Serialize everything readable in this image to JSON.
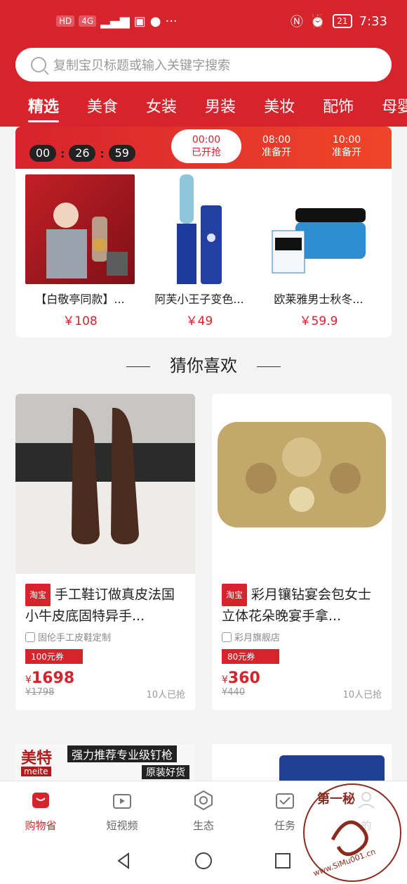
{
  "status": {
    "left_badges": [
      "HD",
      "4G"
    ],
    "time": "7:33",
    "battery": "21"
  },
  "search": {
    "placeholder": "复制宝贝标题或输入关键字搜索"
  },
  "tabs": [
    "精选",
    "美食",
    "女装",
    "男装",
    "美妆",
    "配饰",
    "母婴"
  ],
  "flash_sale": {
    "timer": [
      "00",
      "26",
      "59"
    ],
    "slots": [
      {
        "time": "00:00",
        "status": "已开抢"
      },
      {
        "time": "08:00",
        "status": "准备开"
      },
      {
        "time": "10:00",
        "status": "准备开"
      }
    ],
    "items": [
      {
        "name": "【白敬亭同款】...",
        "price": "￥108"
      },
      {
        "name": "阿芙小王子变色...",
        "price": "￥49"
      },
      {
        "name": "欧莱雅男士秋冬...",
        "price": "￥59.9"
      }
    ]
  },
  "guess": {
    "title": "猜你喜欢"
  },
  "products": [
    {
      "badge": "淘宝",
      "title": "手工鞋订做真皮法国小牛皮底固特异手...",
      "shop": "固伦手工皮鞋定制",
      "coupon": "100元券",
      "currency": "¥",
      "price": "1698",
      "old_price": "¥1798",
      "sold": "10人已抢"
    },
    {
      "badge": "淘宝",
      "title": "彩月镶钻宴会包女士立体花朵晚宴手拿...",
      "shop": "彩月旗舰店",
      "coupon": "80元券",
      "currency": "¥",
      "price": "360",
      "old_price": "¥440",
      "sold": "10人已抢"
    }
  ],
  "partial_ad": {
    "brand": "美特",
    "brand_en": "meite",
    "slogan": "强力推荐专业级钉枪",
    "slogan2": "原装好货"
  },
  "nav": [
    {
      "label": "购物省"
    },
    {
      "label": "短视频"
    },
    {
      "label": "生态"
    },
    {
      "label": "任务"
    },
    {
      "label": "的"
    }
  ],
  "watermark": {
    "text": "第一秘",
    "url": "www.SiMu001.cn"
  },
  "colors": {
    "primary": "#d7232c"
  }
}
